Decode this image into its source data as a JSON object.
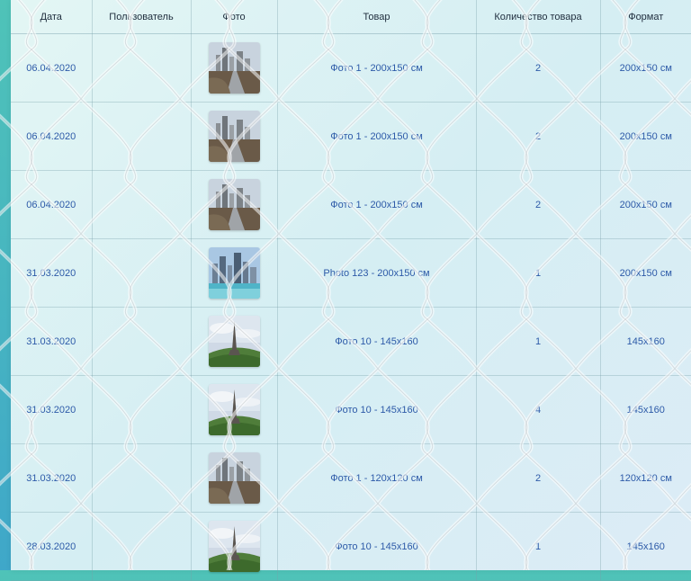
{
  "columns": [
    "Дата",
    "Пользователь",
    "Фото",
    "Товар",
    "Количество товара",
    "Формат"
  ],
  "rows": [
    {
      "date": "06.04.2020",
      "user": "",
      "photo": "city-skyline-road",
      "product": "Фото 1 - 200x150 см",
      "qty": "2",
      "format": "200x150 см"
    },
    {
      "date": "06.04.2020",
      "user": "",
      "photo": "city-skyline-road",
      "product": "Фото 1 - 200x150 см",
      "qty": "2",
      "format": "200x150 см"
    },
    {
      "date": "06.04.2020",
      "user": "",
      "photo": "city-skyline-road",
      "product": "Фото 1 - 200x150 см",
      "qty": "2",
      "format": "200x150 см"
    },
    {
      "date": "31.03.2020",
      "user": "",
      "photo": "city-skyline-water",
      "product": "Photo 123 - 200x150 см",
      "qty": "1",
      "format": "200x150 см"
    },
    {
      "date": "31.03.2020",
      "user": "",
      "photo": "eiffel-tower",
      "product": "Фото 10 - 145x160",
      "qty": "1",
      "format": "145x160"
    },
    {
      "date": "31.03.2020",
      "user": "",
      "photo": "eiffel-tower",
      "product": "Фото 10 - 145x160",
      "qty": "4",
      "format": "145x160"
    },
    {
      "date": "31.03.2020",
      "user": "",
      "photo": "city-skyline-road",
      "product": "Фото 1 - 120x120 см",
      "qty": "2",
      "format": "120x120 см"
    },
    {
      "date": "28.03.2020",
      "user": "",
      "photo": "eiffel-tower",
      "product": "Фото 10 - 145x160",
      "qty": "1",
      "format": "145x160"
    }
  ],
  "colors": {
    "link": "#2d5aa8",
    "header_text": "#1f2d3d",
    "background": "#4fc3b8"
  }
}
